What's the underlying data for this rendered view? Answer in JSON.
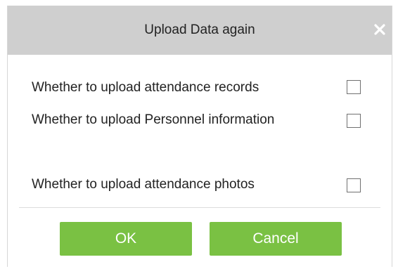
{
  "dialog": {
    "title": "Upload Data again",
    "close_icon": "close-icon",
    "options": [
      {
        "label": "Whether to upload attendance records",
        "checked": false
      },
      {
        "label": "Whether to upload Personnel information",
        "checked": false
      },
      {
        "label": "Whether to upload attendance photos",
        "checked": false
      }
    ],
    "buttons": {
      "ok_label": "OK",
      "cancel_label": "Cancel"
    },
    "colors": {
      "title_bar": "#cfcfcf",
      "button": "#7ac143",
      "button_text": "#ffffff"
    }
  }
}
